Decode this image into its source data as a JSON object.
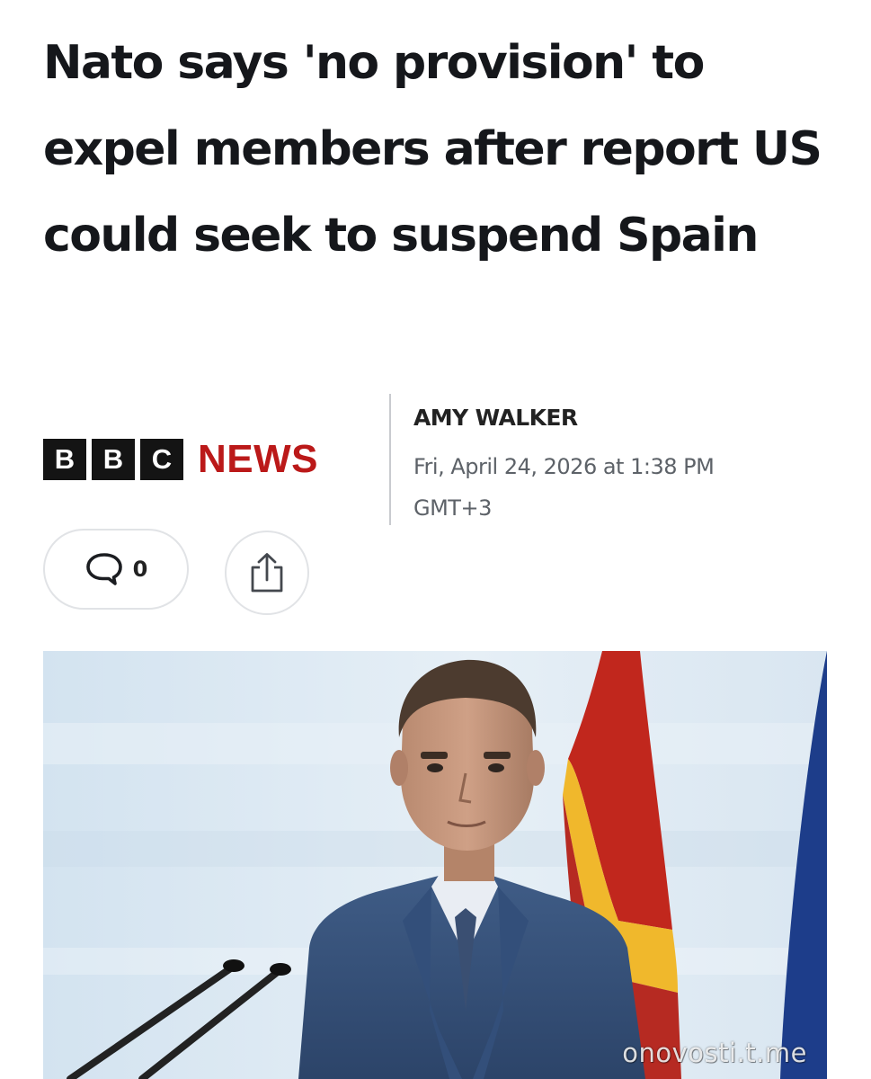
{
  "article": {
    "headline": "Nato says 'no provision' to expel members after report US could seek to suspend Spain",
    "source": {
      "logo_letters": [
        "B",
        "B",
        "C"
      ],
      "logo_word": "NEWS",
      "brand_color": "#bb1919"
    },
    "author": "AMY WALKER",
    "published": "Fri, April 24, 2026 at 1:38 PM GMT+3"
  },
  "actions": {
    "comment_count": "0",
    "comment_icon": "speech-bubble-icon",
    "share_icon": "share-icon"
  },
  "image": {
    "watermark": "onovosti.t.me"
  }
}
